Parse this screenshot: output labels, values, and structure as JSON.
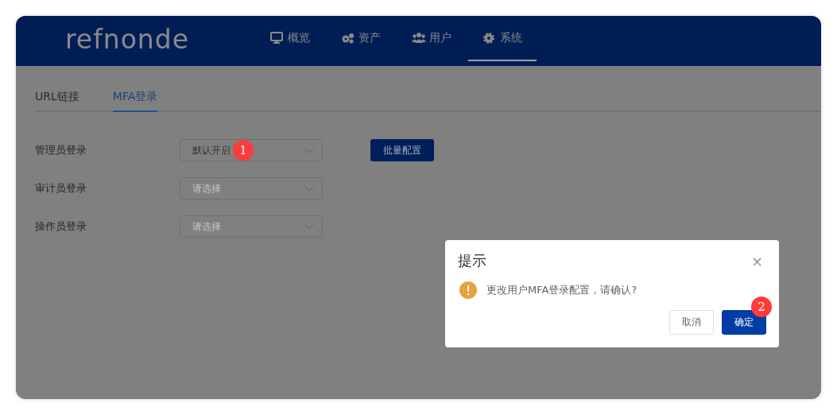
{
  "header": {
    "logo": "refnonde",
    "nav": [
      {
        "label": "概览",
        "kind": "monitor",
        "selected": false
      },
      {
        "label": "资产",
        "kind": "gears",
        "selected": false
      },
      {
        "label": "用户",
        "kind": "users",
        "selected": false
      },
      {
        "label": "系统",
        "kind": "gear",
        "selected": true
      }
    ]
  },
  "tabs": [
    {
      "label": "URL链接",
      "selected": false
    },
    {
      "label": "MFA登录",
      "selected": true
    }
  ],
  "form": {
    "rows": [
      {
        "label": "管理员登录",
        "value": "默认开启",
        "badge": "1"
      },
      {
        "label": "审计员登录",
        "placeholder": "请选择"
      },
      {
        "label": "操作员登录",
        "placeholder": "请选择"
      }
    ],
    "batch_button": "批量配置"
  },
  "dialog": {
    "title": "提示",
    "close": "×",
    "message": "更改用户MFA登录配置，请确认?",
    "buttons": [
      {
        "label": "取消",
        "kind": "plain"
      },
      {
        "label": "确定",
        "kind": "primary",
        "badge": "2"
      }
    ]
  }
}
